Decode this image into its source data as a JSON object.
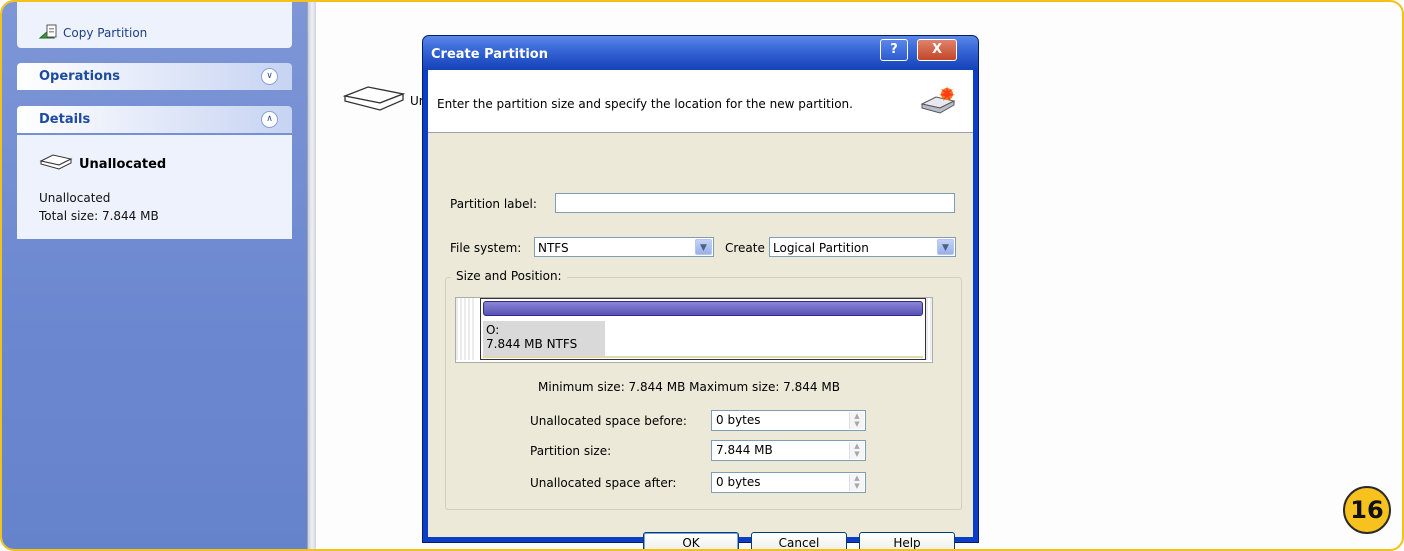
{
  "sidebar": {
    "copy_partition": "Copy Partition",
    "operations_title": "Operations",
    "details_title": "Details",
    "details": {
      "name": "Unallocated",
      "type": "Unallocated",
      "total_size": "Total size: 7.844 MB"
    }
  },
  "main": {
    "disk_label": "Ur"
  },
  "dialog": {
    "title": "Create Partition",
    "help_btn": "?",
    "close_btn": "X",
    "message": "Enter the partition size and specify the location for the new partition.",
    "partition_label_text": "Partition label:",
    "partition_label_value": "",
    "file_system_text": "File system:",
    "file_system_value": "NTFS",
    "create_as_text": "Create as:",
    "create_as_value": "Logical Partition",
    "size_position_title": "Size and Position:",
    "bar_drive": "O:",
    "bar_size": "7.844 MB  NTFS",
    "minmax": "Minimum size: 7.844 MB   Maximum size: 7.844 MB",
    "unalloc_before_text": "Unallocated space before:",
    "unalloc_before_value": "0 bytes",
    "partition_size_text": "Partition size:",
    "partition_size_value": "7.844 MB",
    "unalloc_after_text": "Unallocated space after:",
    "unalloc_after_value": "0 bytes",
    "ok": "OK",
    "cancel": "Cancel",
    "help": "Help"
  },
  "step_number": "16",
  "colors": {
    "sidebar": "#6b87cf",
    "titlebar": "#1442b8",
    "partition_bar": "#5952b6",
    "badge": "#f7c21d"
  }
}
